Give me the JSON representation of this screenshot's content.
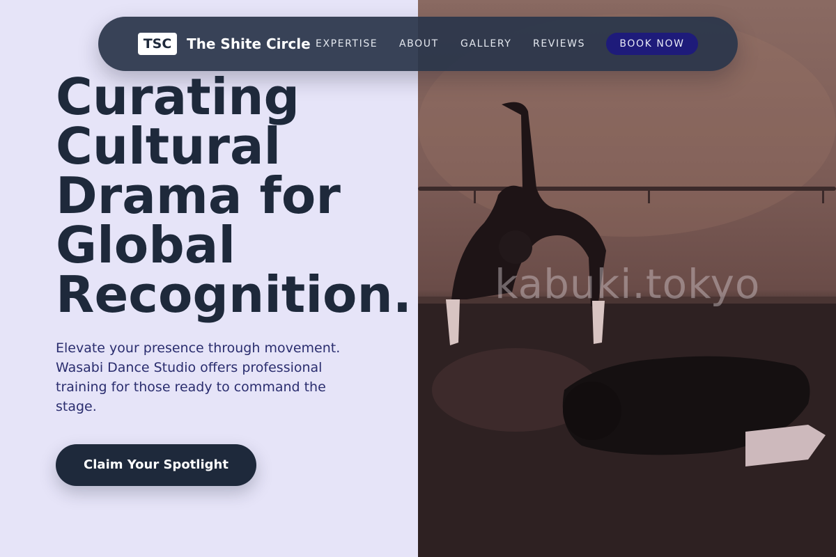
{
  "nav": {
    "logo_text": "TSC",
    "brand_name": "The Shite Circle",
    "links": [
      {
        "label": "EXPERTISE"
      },
      {
        "label": "ABOUT"
      },
      {
        "label": "GALLERY"
      },
      {
        "label": "REVIEWS"
      }
    ],
    "cta_label": "BOOK NOW"
  },
  "hero": {
    "title": "Curating Cultural Drama for Global Recognition.",
    "subtitle": "Elevate your presence through movement. Wasabi Dance Studio offers professional training for those ready to command the stage.",
    "cta_label": "Claim Your Spotlight"
  },
  "image": {
    "watermark": "kabuki.tokyo",
    "description_icon": "dancer-photo"
  },
  "colors": {
    "background": "#e6e4f8",
    "nav_bg": "#2a364a",
    "primary_text": "#1e293b",
    "accent_button": "#1e1b7a"
  }
}
